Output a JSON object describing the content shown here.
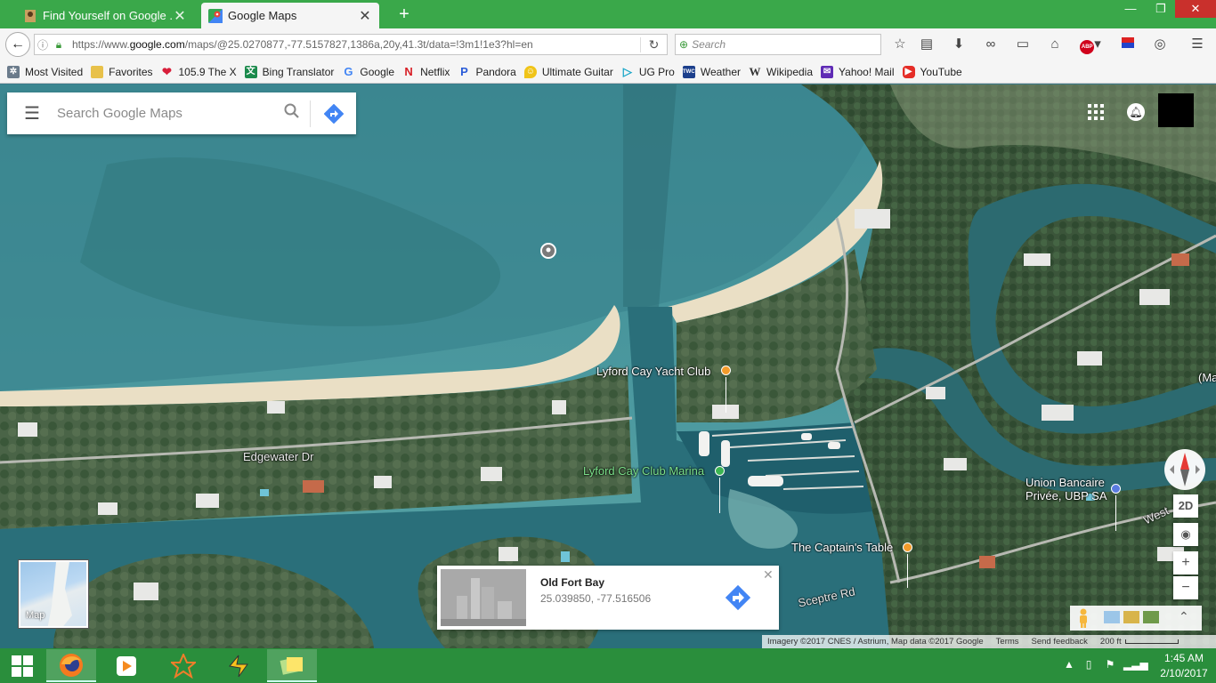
{
  "browser": {
    "tabs": [
      {
        "label": "Find Yourself on Google ...",
        "active": false
      },
      {
        "label": "Google Maps",
        "active": true
      }
    ],
    "url_prefix": "https://www.",
    "url_domain": "google.com",
    "url_rest": "/maps/@25.0270877,-77.5157827,1386a,20y,41.3t/data=!3m1!1e3?hl=en",
    "search_placeholder": "Search",
    "bookmarks": [
      {
        "label": "Most Visited",
        "icon": "gear-icon",
        "color": "#6b7b8b"
      },
      {
        "label": "Favorites",
        "icon": "folder-icon",
        "color": "#e8c14a"
      },
      {
        "label": "105.9 The X",
        "icon": "heart-radio-icon",
        "color": "#d81e3a"
      },
      {
        "label": "Bing Translator",
        "icon": "translator-icon",
        "color": "#1b8a4c"
      },
      {
        "label": "Google",
        "icon": "google-icon",
        "color": "#4285f4"
      },
      {
        "label": "Netflix",
        "icon": "netflix-icon",
        "color": "#d81f26"
      },
      {
        "label": "Pandora",
        "icon": "pandora-icon",
        "color": "#2a5cd8"
      },
      {
        "label": "Ultimate Guitar",
        "icon": "guitar-pick-icon",
        "color": "#f0c419"
      },
      {
        "label": "UG Pro",
        "icon": "play-circle-icon",
        "color": "#1aa6c8"
      },
      {
        "label": "Weather",
        "icon": "weather-icon",
        "color": "#1c3f8c"
      },
      {
        "label": "Wikipedia",
        "icon": "wikipedia-icon",
        "color": "#333333"
      },
      {
        "label": "Yahoo! Mail",
        "icon": "yahoo-mail-icon",
        "color": "#5f2bb5"
      },
      {
        "label": "YouTube",
        "icon": "youtube-icon",
        "color": "#e52d27"
      }
    ]
  },
  "maps": {
    "search_placeholder": "Search Google Maps",
    "labels": {
      "yacht_club": "Lyford Cay Yacht Club",
      "marina": "Lyford Cay Club Marina",
      "edgewater": "Edgewater Dr",
      "bank": "Union Bancaire\nPrivée, UBP SA",
      "captains_table": "The Captain's Table",
      "sceptre": "Sceptre Rd",
      "west": "West",
      "edge": "(Ma"
    },
    "controls": {
      "two_d": "2D",
      "zoom_in": "+",
      "zoom_out": "−"
    },
    "minimap_label": "Map",
    "place_card": {
      "name": "Old Fort Bay",
      "coords": "25.039850, -77.516506"
    },
    "attribution": {
      "imagery": "Imagery ©2017 CNES / Astrium, Map data ©2017 Google",
      "terms": "Terms",
      "feedback": "Send feedback",
      "scale": "200 ft"
    },
    "colors": {
      "sea": "#3f8f97",
      "deep": "#2d6c7a",
      "land": "#3e5a3a",
      "sand": "#e9dcc0"
    }
  },
  "taskbar": {
    "time": "1:45 AM",
    "date": "2/10/2017"
  }
}
